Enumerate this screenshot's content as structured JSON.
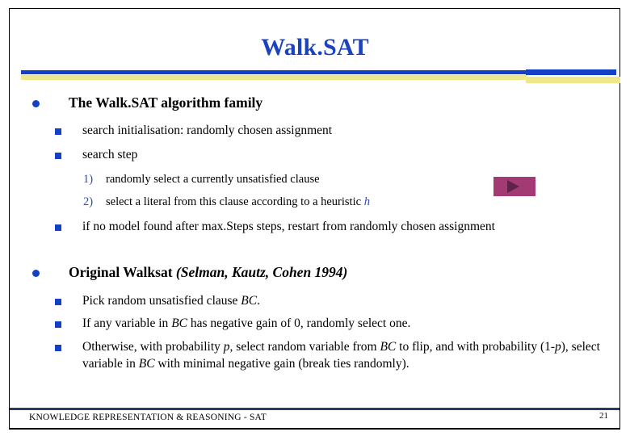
{
  "slide": {
    "title": "Walk.SAT",
    "page_number": "21",
    "footer": "KNOWLEDGE REPRESENTATION & REASONING - SAT",
    "colors": {
      "title_blue": "#1b43bd",
      "rule_blue": "#1340c4",
      "rule_yellow": "#eee88c",
      "bullet_blue": "#1340c4",
      "play_button": "#a33a74",
      "play_triangle": "#5d2348",
      "footer_rule": "#2b3a63"
    }
  },
  "content": {
    "section1": {
      "heading": "The Walk.SAT algorithm family",
      "items": [
        {
          "text": "search initialisation: randomly chosen assignment"
        },
        {
          "text": "search step"
        }
      ],
      "steps": [
        {
          "number": "1)",
          "text_before": "randomly select a currently unsatisfied clause",
          "math": "",
          "text_after": ""
        },
        {
          "number": "2)",
          "text_before": "select a literal from this clause according to a heuristic ",
          "math": "h",
          "text_after": ""
        }
      ],
      "restart_item": "if no model found after max.Steps steps, restart from randomly chosen assignment"
    },
    "section2": {
      "heading_bold": "Original Walksat ",
      "heading_italic": "(Selman, Kautz, Cohen 1994)",
      "items": [
        {
          "parts": [
            {
              "t": "Pick random unsatisfied clause ",
              "style": "normal"
            },
            {
              "t": "BC",
              "style": "italic"
            },
            {
              "t": ".",
              "style": "normal"
            }
          ]
        },
        {
          "parts": [
            {
              "t": "If any variable in ",
              "style": "normal"
            },
            {
              "t": "BC",
              "style": "italic"
            },
            {
              "t": " has negative gain of 0, randomly select one.",
              "style": "normal"
            }
          ]
        },
        {
          "parts": [
            {
              "t": "Otherwise, with probability ",
              "style": "normal"
            },
            {
              "t": "p",
              "style": "italic"
            },
            {
              "t": ", select random variable from ",
              "style": "normal"
            },
            {
              "t": "BC",
              "style": "italic"
            },
            {
              "t": " to flip, and with probability (1-",
              "style": "normal"
            },
            {
              "t": "p",
              "style": "italic"
            },
            {
              "t": "), select variable in ",
              "style": "normal"
            },
            {
              "t": "BC",
              "style": "italic"
            },
            {
              "t": " with minimal negative gain (break ties randomly).",
              "style": "normal"
            }
          ]
        }
      ]
    },
    "media": {
      "play_button_label": "play-video"
    }
  }
}
